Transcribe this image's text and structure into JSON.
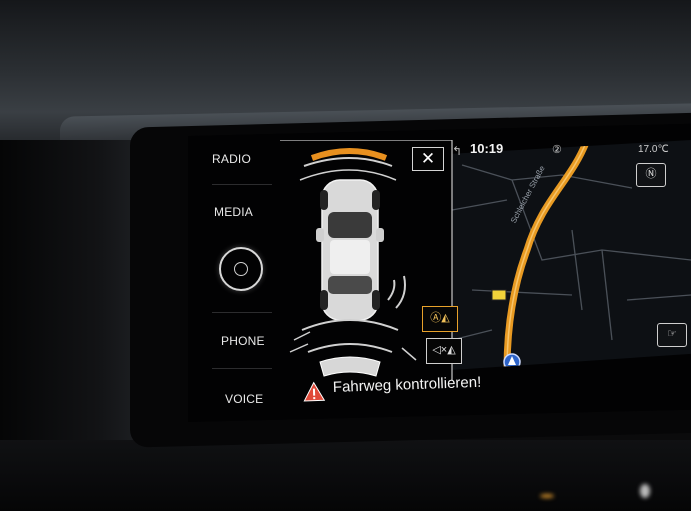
{
  "menu": {
    "radio": "RADIO",
    "media": "MEDIA",
    "phone": "PHONE",
    "voice": "VOICE"
  },
  "parking": {
    "close_label": "✕",
    "warning_text": "Fahrweg kontrollieren!",
    "front_sensor_color": "#e8901f",
    "mode_auto_label": "Ⓐ◭",
    "mode_sound_label": "◁×◭"
  },
  "map": {
    "clock": "10:19",
    "badge": "②",
    "temperature": "17.0℃",
    "street_label": "Schleicher Straße",
    "compass_label": "Ⓝ",
    "route_color": "#e89a22"
  }
}
